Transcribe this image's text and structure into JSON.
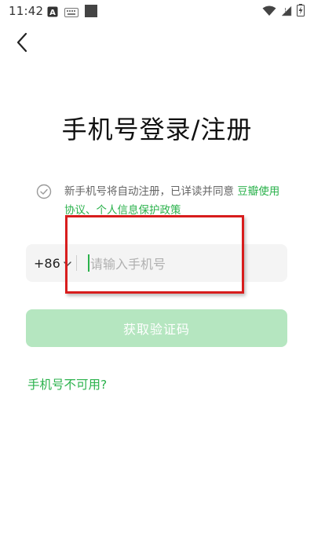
{
  "status_bar": {
    "time": "11:42",
    "icons_left": [
      "a-icon",
      "keyboard-icon",
      "square-icon"
    ],
    "icons_right": [
      "wifi-icon",
      "signal-icon",
      "battery-charging-icon"
    ]
  },
  "nav": {
    "back_icon": "chevron-left-icon"
  },
  "title": "手机号登录/注册",
  "agreement": {
    "text": "新手机号将自动注册，已详读并同意",
    "link_main": " 豆瓣使用协议",
    "separator": "、",
    "link_privacy": "个人信息保护政策"
  },
  "phone": {
    "country_code": "+86",
    "placeholder": "请输入手机号",
    "value": ""
  },
  "button": {
    "get_code_label": "获取验证码"
  },
  "links": {
    "phone_unavailable": "手机号不可用?"
  },
  "colors": {
    "accent": "#2bb24c",
    "button_bg_disabled": "#b5e6c0",
    "highlight": "#d81d1d"
  }
}
